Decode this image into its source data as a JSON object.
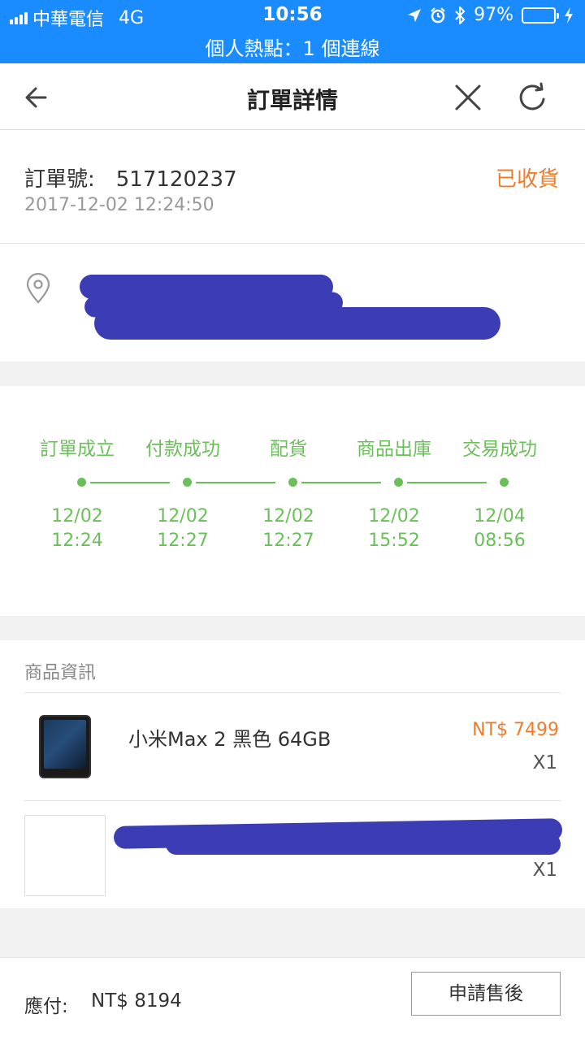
{
  "status_bar": {
    "carrier": "中華電信",
    "network": "4G",
    "time": "10:56",
    "battery_percent": "97%",
    "battery_level": 0.97,
    "hotspot_text": "個人熱點：1 個連線",
    "icons": [
      "signal-icon",
      "location-arrow-icon",
      "alarm-icon",
      "bluetooth-icon",
      "battery-icon",
      "charging-icon"
    ]
  },
  "navbar": {
    "title": "訂單詳情",
    "icons": [
      "back-arrow-icon",
      "close-icon",
      "refresh-icon"
    ]
  },
  "order": {
    "number_label": "訂單號:",
    "number": "517120237",
    "status": "已收貨",
    "datetime": "2017-12-02 12:24:50"
  },
  "address": {
    "icon": "location-pin-icon"
  },
  "progress": {
    "steps": [
      {
        "label": "訂單成立",
        "date": "12/02",
        "time": "12:24"
      },
      {
        "label": "付款成功",
        "date": "12/02",
        "time": "12:27"
      },
      {
        "label": "配貨",
        "date": "12/02",
        "time": "12:27"
      },
      {
        "label": "商品出庫",
        "date": "12/02",
        "time": "15:52"
      },
      {
        "label": "交易成功",
        "date": "12/04",
        "time": "08:56"
      }
    ]
  },
  "goods": {
    "heading": "商品資訊",
    "items": [
      {
        "name": "小米Max 2 黑色 64GB",
        "price": "NT$ 7499",
        "qty": "X1"
      },
      {
        "qty": "X1"
      }
    ]
  },
  "footer": {
    "pay_label": "應付:",
    "pay_amount": "NT$ 8194",
    "after_sale_button": "申請售後"
  },
  "colors": {
    "status_bar_bg": "#1a8cff",
    "accent_orange": "#f07c2a",
    "progress_green": "#6bbf5a",
    "redaction": "#3c3cb4"
  }
}
